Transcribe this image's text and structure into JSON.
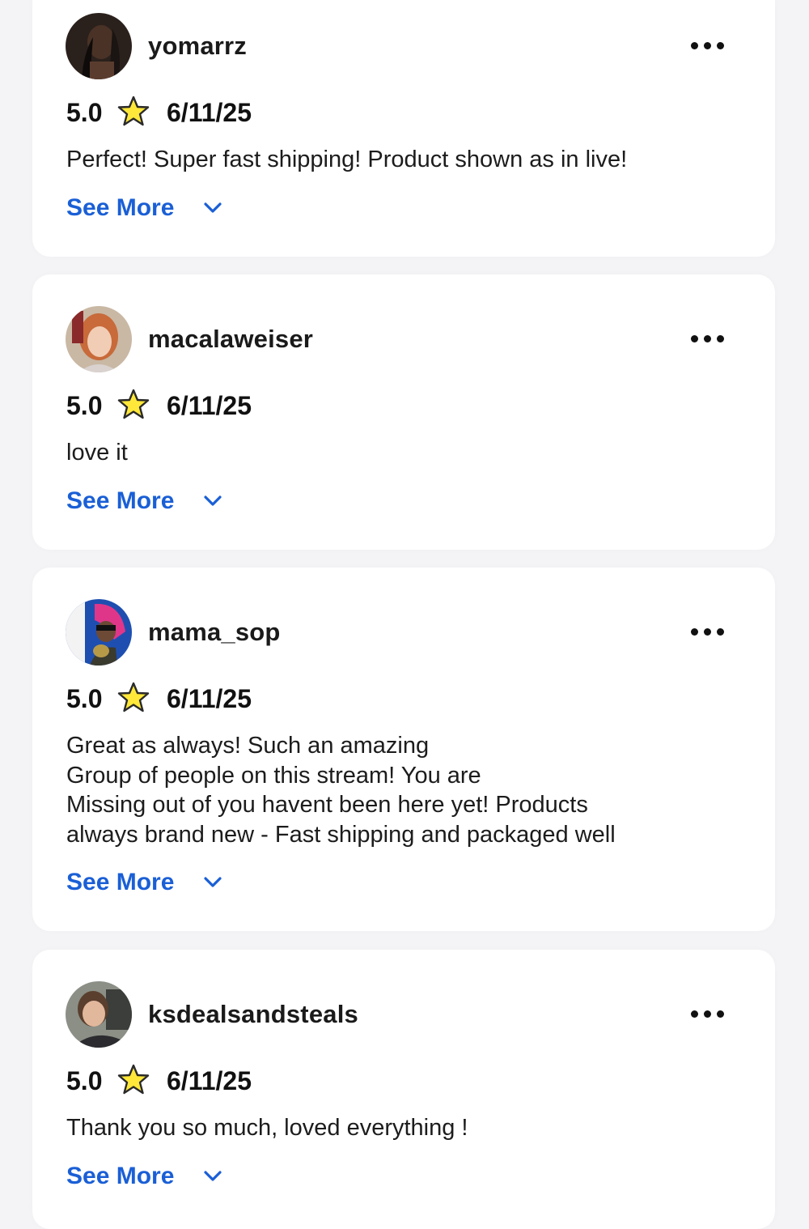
{
  "colors": {
    "link": "#1a5fd6",
    "star_fill": "#ffe83a",
    "star_stroke": "#2a2a2a",
    "card_bg": "#ffffff",
    "page_bg": "#f4f4f6"
  },
  "icons": {
    "star": "star-icon",
    "more": "more-dots-icon",
    "chevron": "chevron-down-icon"
  },
  "reviews": [
    {
      "username": "yomarrz",
      "rating": "5.0",
      "date": "6/11/25",
      "text": "Perfect! Super fast shipping! Product shown as in live!",
      "see_more": "See More"
    },
    {
      "username": "macalaweiser",
      "rating": "5.0",
      "date": "6/11/25",
      "text": "love it",
      "see_more": "See More"
    },
    {
      "username": "mama_sop",
      "rating": "5.0",
      "date": "6/11/25",
      "text": "Great as always! Such an amazing\nGroup of people on this stream! You are\nMissing out of you havent been here yet! Products\nalways brand new - Fast shipping and packaged well",
      "see_more": "See More"
    },
    {
      "username": "ksdealsandsteals",
      "rating": "5.0",
      "date": "6/11/25",
      "text": "Thank you so much, loved everything !",
      "see_more": "See More"
    }
  ]
}
